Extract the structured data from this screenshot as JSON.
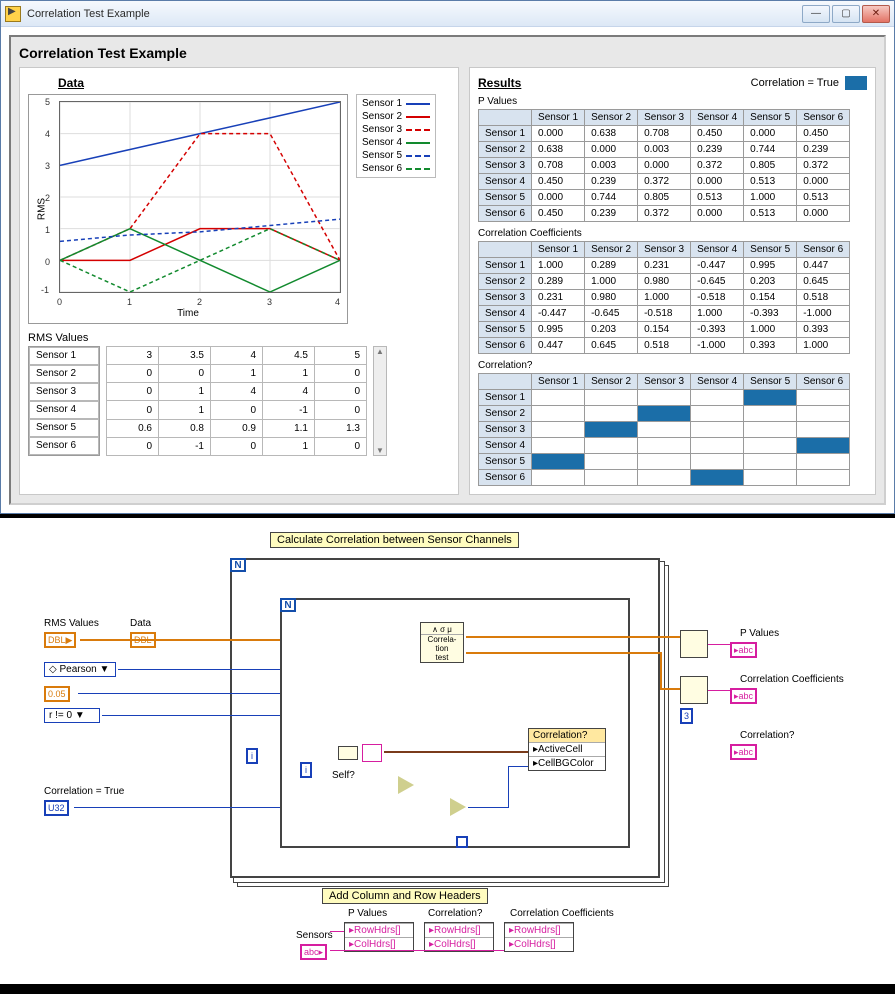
{
  "window": {
    "title": "Correlation Test Example"
  },
  "panel_title": "Correlation Test Example",
  "left": {
    "heading": "Data",
    "ylabel": "RMS",
    "xlabel": "Time",
    "rms_label": "RMS Values"
  },
  "right": {
    "heading": "Results",
    "corr_key": "Correlation = True",
    "sec_pvals": "P Values",
    "sec_coeff": "Correlation Coefficients",
    "sec_corr": "Correlation?"
  },
  "sensors": [
    "Sensor 1",
    "Sensor 2",
    "Sensor 3",
    "Sensor 4",
    "Sensor 5",
    "Sensor 6"
  ],
  "chart_data": {
    "type": "line",
    "title": "Data",
    "xlabel": "Time",
    "ylabel": "RMS",
    "x": [
      0,
      1,
      2,
      3,
      4
    ],
    "ylim": [
      -1,
      5
    ],
    "xlim": [
      0,
      4
    ],
    "series": [
      {
        "name": "Sensor 1",
        "values": [
          3,
          3.5,
          4,
          4.5,
          5
        ],
        "color": "#1840b8",
        "dashed": false
      },
      {
        "name": "Sensor 2",
        "values": [
          0,
          0,
          1,
          1,
          0
        ],
        "color": "#d40000",
        "dashed": false
      },
      {
        "name": "Sensor 3",
        "values": [
          0,
          1,
          4,
          4,
          0
        ],
        "color": "#d40000",
        "dashed": true
      },
      {
        "name": "Sensor 4",
        "values": [
          0,
          1,
          0,
          -1,
          0
        ],
        "color": "#128a2e",
        "dashed": false
      },
      {
        "name": "Sensor 5",
        "values": [
          0.6,
          0.8,
          0.9,
          1.1,
          1.3
        ],
        "color": "#1840b8",
        "dashed": true
      },
      {
        "name": "Sensor 6",
        "values": [
          0,
          -1,
          0,
          1,
          0
        ],
        "color": "#128a2e",
        "dashed": true
      }
    ]
  },
  "rms_values": [
    [
      3,
      3.5,
      4,
      4.5,
      5
    ],
    [
      0,
      0,
      1,
      1,
      0
    ],
    [
      0,
      1,
      4,
      4,
      0
    ],
    [
      0,
      1,
      0,
      -1,
      0
    ],
    [
      0.6,
      0.8,
      0.9,
      1.1,
      1.3
    ],
    [
      0,
      -1,
      0,
      1,
      0
    ]
  ],
  "p_values": [
    [
      0.0,
      0.638,
      0.708,
      0.45,
      0.0,
      0.45
    ],
    [
      0.638,
      0.0,
      0.003,
      0.239,
      0.744,
      0.239
    ],
    [
      0.708,
      0.003,
      0.0,
      0.372,
      0.805,
      0.372
    ],
    [
      0.45,
      0.239,
      0.372,
      0.0,
      0.513,
      0.0
    ],
    [
      0.0,
      0.744,
      0.805,
      0.513,
      1.0,
      0.513
    ],
    [
      0.45,
      0.239,
      0.372,
      0.0,
      0.513,
      0.0
    ]
  ],
  "corr_coeff": [
    [
      1.0,
      0.289,
      0.231,
      -0.447,
      0.995,
      0.447
    ],
    [
      0.289,
      1.0,
      0.98,
      -0.645,
      0.203,
      0.645
    ],
    [
      0.231,
      0.98,
      1.0,
      -0.518,
      0.154,
      0.518
    ],
    [
      -0.447,
      -0.645,
      -0.518,
      1.0,
      -0.393,
      -1.0
    ],
    [
      0.995,
      0.203,
      0.154,
      -0.393,
      1.0,
      0.393
    ],
    [
      0.447,
      0.645,
      0.518,
      -1.0,
      0.393,
      1.0
    ]
  ],
  "correlation_bool": [
    [
      false,
      false,
      false,
      false,
      true,
      false
    ],
    [
      false,
      false,
      true,
      false,
      false,
      false
    ],
    [
      false,
      true,
      false,
      false,
      false,
      false
    ],
    [
      false,
      false,
      false,
      false,
      false,
      true
    ],
    [
      true,
      false,
      false,
      false,
      false,
      false
    ],
    [
      false,
      false,
      false,
      true,
      false,
      false
    ]
  ],
  "bd": {
    "title": "Calculate Correlation between Sensor Channels",
    "footer": "Add Column and Row Headers",
    "rms_values": "RMS Values",
    "data": "Data",
    "pearson": "Pearson",
    "alpha": "0.05",
    "rtest": "r != 0",
    "corr_true": "Correlation = True",
    "corr_test": "Correla-\ntion\ntest",
    "i": "i",
    "self": "Self?",
    "prop_hdr": "Correlation?",
    "prop_ac": "ActiveCell",
    "prop_bg": "CellBGColor",
    "out_pvals": "P Values",
    "out_coeff": "Correlation Coefficients",
    "out_corr": "Correlation?",
    "three": "3",
    "sensors": "Sensors",
    "rowhdrs": "RowHdrs[]",
    "colhdrs": "ColHdrs[]",
    "foot_pvals": "P Values",
    "foot_corr": "Correlation?",
    "foot_coeff": "Correlation Coefficients",
    "dbl": "DBL",
    "abc": "abc",
    "u32": "U32"
  }
}
